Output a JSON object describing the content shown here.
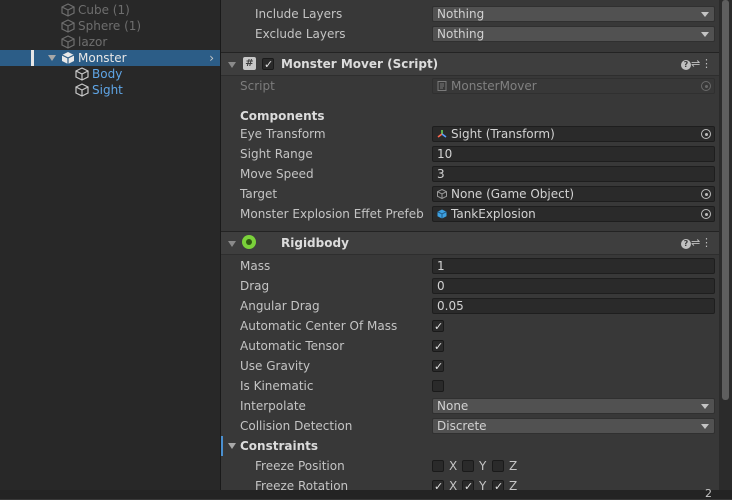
{
  "hierarchy": {
    "items": [
      {
        "label": "Cube (1)",
        "state": "inactive"
      },
      {
        "label": "Sphere (1)",
        "state": "inactive"
      },
      {
        "label": "lazor",
        "state": "inactive"
      },
      {
        "label": "Monster",
        "state": "selected"
      },
      {
        "label": "Body",
        "state": "child"
      },
      {
        "label": "Sight",
        "state": "child"
      }
    ]
  },
  "inspector": {
    "raycast": {
      "include_layers_label": "Include Layers",
      "include_layers_value": "Nothing",
      "exclude_layers_label": "Exclude Layers",
      "exclude_layers_value": "Nothing"
    },
    "monster_mover": {
      "title": "Monster Mover (Script)",
      "script_label": "Script",
      "script_value": "MonsterMover",
      "components_heading": "Components",
      "eye_transform_label": "Eye Transform",
      "eye_transform_value": "Sight (Transform)",
      "sight_range_label": "Sight Range",
      "sight_range_value": "10",
      "move_speed_label": "Move Speed",
      "move_speed_value": "3",
      "target_label": "Target",
      "target_value": "None (Game Object)",
      "explosion_label": "Monster Explosion Effet Prefeb",
      "explosion_value": "TankExplosion"
    },
    "rigidbody": {
      "title": "Rigidbody",
      "mass_label": "Mass",
      "mass_value": "1",
      "drag_label": "Drag",
      "drag_value": "0",
      "angular_drag_label": "Angular Drag",
      "angular_drag_value": "0.05",
      "auto_com_label": "Automatic Center Of Mass",
      "auto_com_checked": true,
      "auto_tensor_label": "Automatic Tensor",
      "auto_tensor_checked": true,
      "use_gravity_label": "Use Gravity",
      "use_gravity_checked": true,
      "is_kinematic_label": "Is Kinematic",
      "is_kinematic_checked": false,
      "interpolate_label": "Interpolate",
      "interpolate_value": "None",
      "collision_label": "Collision Detection",
      "collision_value": "Discrete",
      "constraints_label": "Constraints",
      "freeze_position_label": "Freeze Position",
      "freeze_rotation_label": "Freeze Rotation",
      "axis_x": "X",
      "axis_y": "Y",
      "axis_z": "Z"
    }
  },
  "footer": {
    "page_indicator": "2"
  },
  "colors": {
    "selection": "#2c5d87",
    "child_link": "#5fa5e6",
    "rigidbody_icon": "#7ad13a"
  }
}
